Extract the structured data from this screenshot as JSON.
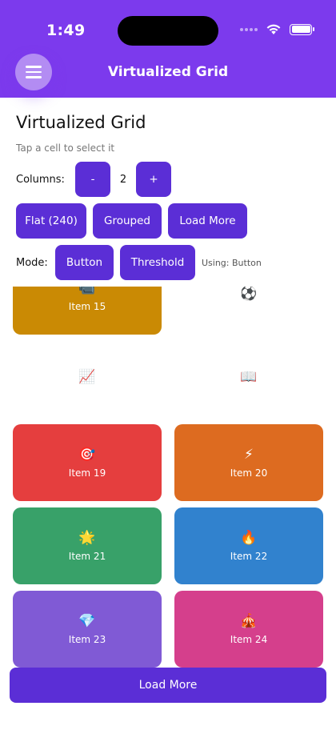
{
  "status_bar": {
    "time": "1:49"
  },
  "header": {
    "title": "Virtualized Grid"
  },
  "page": {
    "title": "Virtualized Grid",
    "subtitle": "Tap a cell to select it"
  },
  "columns": {
    "label": "Columns:",
    "decrement": "-",
    "value": "2",
    "increment": "+"
  },
  "load_buttons": {
    "flat": "Flat (240)",
    "grouped": "Grouped",
    "load_more": "Load More"
  },
  "mode": {
    "label": "Mode:",
    "button": "Button",
    "threshold": "Threshold",
    "using": "Using: Button"
  },
  "grid": {
    "cells": [
      {
        "icon": "📹",
        "label": "Item 15",
        "color": "#ca8a04"
      },
      {
        "icon": "⚽",
        "label": "",
        "color": "#ffffff"
      },
      {
        "icon": "📈",
        "label": "",
        "color": "#ffffff"
      },
      {
        "icon": "📖",
        "label": "",
        "color": "#ffffff"
      },
      {
        "icon": "🎯",
        "label": "Item 19",
        "color": "#e53e3e"
      },
      {
        "icon": "⚡",
        "label": "Item 20",
        "color": "#dd6b20"
      },
      {
        "icon": "🌟",
        "label": "Item 21",
        "color": "#38a169"
      },
      {
        "icon": "🔥",
        "label": "Item 22",
        "color": "#3182ce"
      },
      {
        "icon": "💎",
        "label": "Item 23",
        "color": "#805ad5"
      },
      {
        "icon": "🎪",
        "label": "Item 24",
        "color": "#d53f8c"
      }
    ]
  },
  "footer": {
    "load_more": "Load More"
  }
}
